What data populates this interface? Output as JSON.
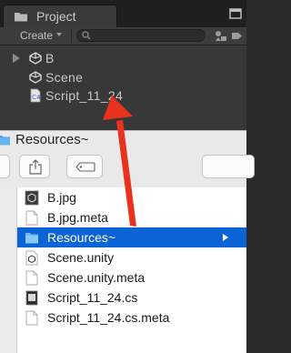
{
  "unity_panel": {
    "tab_title": "Project",
    "toolbar": {
      "create_label": "Create"
    },
    "assets": [
      {
        "label": "B",
        "icon": "unity-scene-icon"
      },
      {
        "label": "Scene",
        "icon": "unity-scene-icon"
      },
      {
        "label": "Script_11_24",
        "icon": "csharp-script-icon"
      }
    ]
  },
  "finder": {
    "window_title": "Resources~",
    "files": [
      {
        "label": "B.jpg",
        "icon": "image-file-icon"
      },
      {
        "label": "B.jpg.meta",
        "icon": "document-icon"
      },
      {
        "label": "Resources~",
        "icon": "folder-icon",
        "selected": true
      },
      {
        "label": "Scene.unity",
        "icon": "unity-scene-icon"
      },
      {
        "label": "Scene.unity.meta",
        "icon": "document-icon"
      },
      {
        "label": "Script_11_24.cs",
        "icon": "cs-file-icon"
      },
      {
        "label": "Script_11_24.cs.meta",
        "icon": "document-icon"
      }
    ]
  },
  "annotation": {
    "arrow_color": "#e8321e"
  },
  "colors": {
    "selection": "#0b64d6",
    "unity_bg": "#383838"
  }
}
